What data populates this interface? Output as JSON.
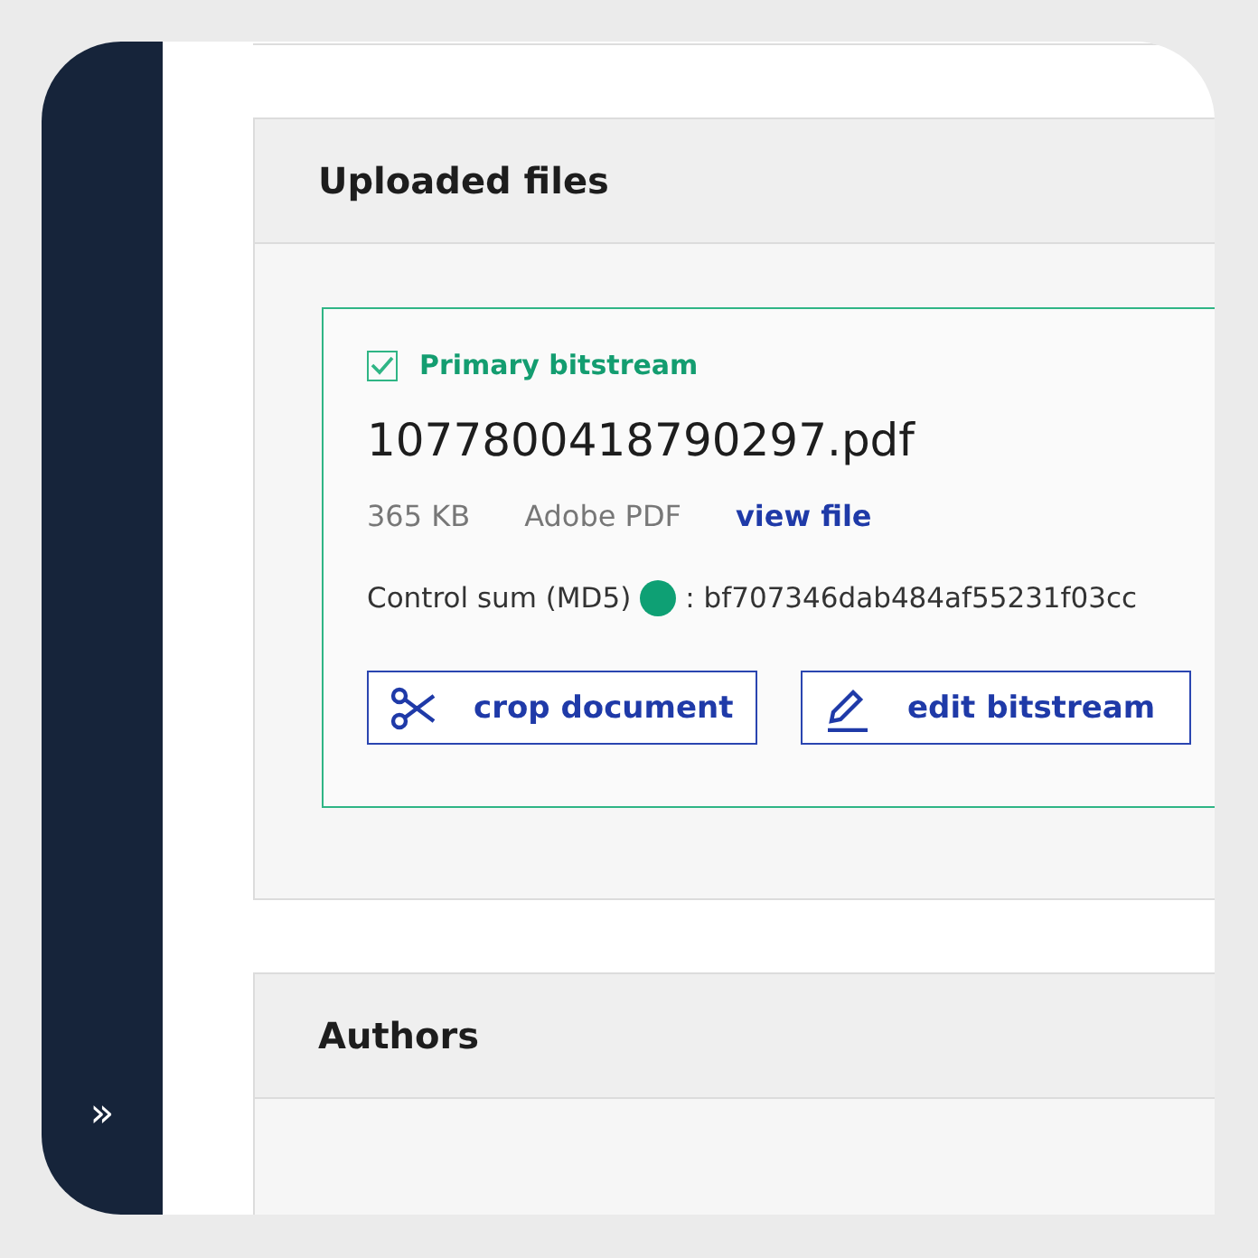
{
  "sidebar": {
    "toggle": "»"
  },
  "panels": [
    {
      "title": "Uploaded files",
      "files": [
        {
          "primary": {
            "label": "Primary bitstream",
            "checked": true
          },
          "name": "1077800418790297.pdf",
          "size": "365 KB",
          "format": "Adobe PDF",
          "link": "view file",
          "checksum_label": "Control sum (MD5)",
          "checksum": ": bf707346dab484af55231f03cc",
          "actions": [
            {
              "kind": "crop",
              "label": "crop document"
            },
            {
              "kind": "edit",
              "label": "edit bitstream"
            }
          ]
        }
      ]
    },
    {
      "title": "Authors"
    }
  ]
}
